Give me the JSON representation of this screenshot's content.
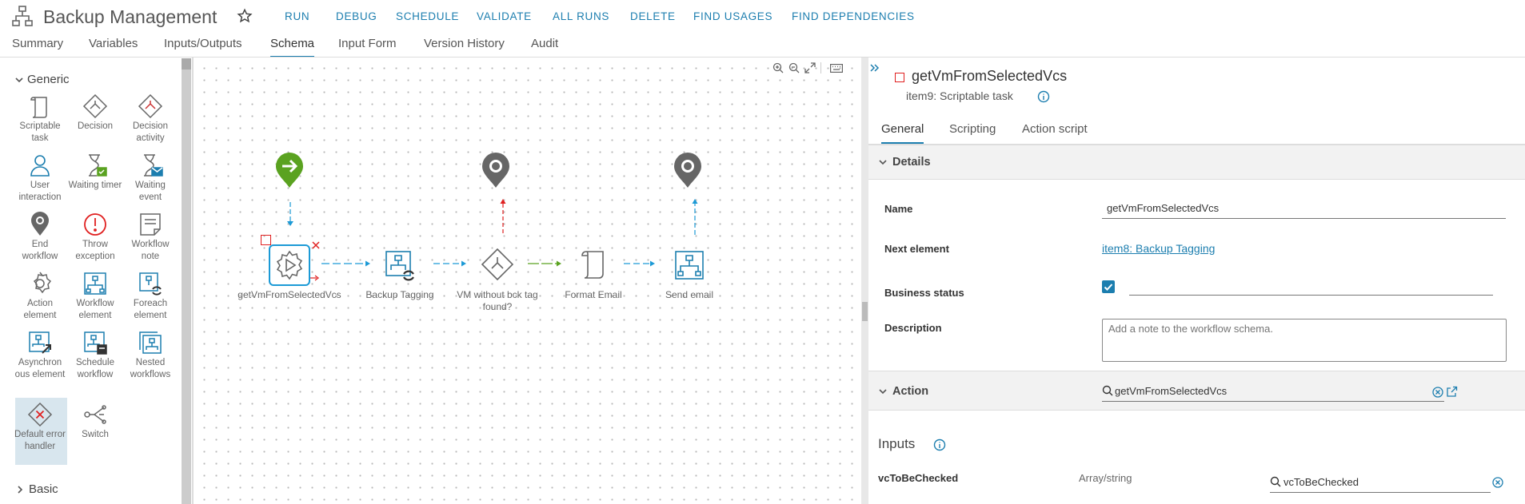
{
  "header": {
    "title": "Backup Management",
    "actions": [
      "RUN",
      "DEBUG",
      "SCHEDULE",
      "VALIDATE",
      "ALL RUNS",
      "DELETE",
      "FIND USAGES",
      "FIND DEPENDENCIES"
    ]
  },
  "tabs": [
    "Summary",
    "Variables",
    "Inputs/Outputs",
    "Schema",
    "Input Form",
    "Version History",
    "Audit"
  ],
  "active_tab": "Schema",
  "palette": {
    "group_generic": "Generic",
    "group_basic": "Basic",
    "items": [
      {
        "icon": "scriptable-task-icon",
        "label": "Scriptable task"
      },
      {
        "icon": "decision-icon",
        "label": "Decision"
      },
      {
        "icon": "decision-activity-icon",
        "label": "Decision activity"
      },
      {
        "icon": "user-interaction-icon",
        "label": "User interaction"
      },
      {
        "icon": "waiting-timer-icon",
        "label": "Waiting timer"
      },
      {
        "icon": "waiting-event-icon",
        "label": "Waiting event"
      },
      {
        "icon": "end-workflow-icon",
        "label": "End workflow"
      },
      {
        "icon": "throw-exception-icon",
        "label": "Throw exception"
      },
      {
        "icon": "workflow-note-icon",
        "label": "Workflow note"
      },
      {
        "icon": "action-element-icon",
        "label": "Action element"
      },
      {
        "icon": "workflow-element-icon",
        "label": "Workflow element"
      },
      {
        "icon": "foreach-element-icon",
        "label": "Foreach element"
      },
      {
        "icon": "asynchronous-element-icon",
        "label": "Asynchron ous element"
      },
      {
        "icon": "schedule-workflow-icon",
        "label": "Schedule workflow"
      },
      {
        "icon": "nested-workflows-icon",
        "label": "Nested workflows"
      },
      {
        "icon": "default-error-handler-icon",
        "label": "Default error handler"
      },
      {
        "icon": "switch-icon",
        "label": "Switch"
      }
    ]
  },
  "schema": {
    "nodes": [
      {
        "label": "getVmFromSelectedVcs"
      },
      {
        "label": "Backup Tagging"
      },
      {
        "label": "VM without bck tag found?"
      },
      {
        "label": "Format Email"
      },
      {
        "label": "Send email"
      }
    ]
  },
  "properties": {
    "element_name": "getVmFromSelectedVcs",
    "element_subtitle": "item9: Scriptable task",
    "tabs": [
      "General",
      "Scripting",
      "Action script"
    ],
    "active_tab": "General",
    "details_title": "Details",
    "name_label": "Name",
    "name_value": "getVmFromSelectedVcs",
    "next_element_label": "Next element",
    "next_element_value": "item8: Backup Tagging",
    "business_status_label": "Business status",
    "business_status_checked": true,
    "description_label": "Description",
    "description_placeholder": "Add a note to the workflow schema.",
    "action_title": "Action",
    "action_value": "getVmFromSelectedVcs",
    "inputs_title": "Inputs",
    "inputs": [
      {
        "name": "vcToBeChecked",
        "type": "Array/string",
        "value": "vcToBeChecked"
      }
    ]
  },
  "colors": {
    "accent": "#1c7eaf",
    "start": "#5aa220",
    "error": "#e02020",
    "icon": "#666666"
  }
}
